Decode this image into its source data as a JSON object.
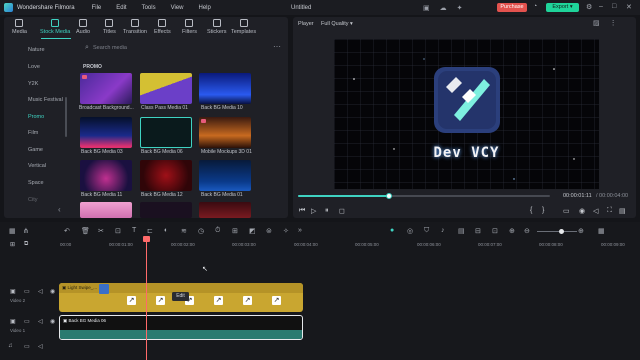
{
  "app": {
    "name": "Wondershare Filmora",
    "document_title": "Untitled"
  },
  "menu": [
    "File",
    "Edit",
    "Tools",
    "View",
    "Help"
  ],
  "header_buttons": {
    "purchase": "Purchase",
    "export": "Export"
  },
  "media_tabs": [
    {
      "label": "Media",
      "icon": "folder-icon"
    },
    {
      "label": "Stock Media",
      "icon": "stock-media-icon",
      "active": true
    },
    {
      "label": "Audio",
      "icon": "music-note-icon"
    },
    {
      "label": "Titles",
      "icon": "text-icon"
    },
    {
      "label": "Transition",
      "icon": "transition-icon"
    },
    {
      "label": "Effects",
      "icon": "effects-icon"
    },
    {
      "label": "Filters",
      "icon": "filters-icon"
    },
    {
      "label": "Stickers",
      "icon": "stickers-icon"
    },
    {
      "label": "Templates",
      "icon": "templates-icon"
    }
  ],
  "sidebar": {
    "items": [
      {
        "label": "Nature"
      },
      {
        "label": "Love"
      },
      {
        "label": "Y2K"
      },
      {
        "label": "Music Festival"
      },
      {
        "label": "Promo",
        "active": true
      },
      {
        "label": "Film"
      },
      {
        "label": "Game"
      },
      {
        "label": "Vertical"
      },
      {
        "label": "Space"
      },
      {
        "label": "City"
      }
    ]
  },
  "search": {
    "placeholder": "Search media"
  },
  "section_label": "PROMO",
  "media_grid": [
    {
      "label": "Broadcast Background...",
      "premium": true
    },
    {
      "label": "Class Pass Media 01"
    },
    {
      "label": "Back BG Media 10"
    },
    {
      "label": "Back BG Media 03"
    },
    {
      "label": "Back BG Media 06",
      "selected": true
    },
    {
      "label": "Mobile Mockups 3D 01",
      "premium": true
    },
    {
      "label": "Back BG Media 11"
    },
    {
      "label": "Back BG Media 12"
    },
    {
      "label": "Back BG Media 01"
    },
    {
      "label": ""
    },
    {
      "label": ""
    },
    {
      "label": ""
    }
  ],
  "player": {
    "label": "Player",
    "quality": "Full Quality",
    "preview_title": "Dev VCY",
    "current_time": "00:00:01:11",
    "total_time": "/ 00:00:04:00",
    "progress_fraction": 0.36
  },
  "timeline": {
    "ruler_ticks": [
      "00:00",
      "00:00:01:00",
      "00:00:02:00",
      "00:00:03:00",
      "00:00:04:00",
      "00:00:05:00",
      "00:00:06:00",
      "00:00:07:00",
      "00:00:08:00",
      "00:00:09:00"
    ],
    "tracks": [
      {
        "label": "Video 2",
        "clip": "Light Swipe_..."
      },
      {
        "label": "Video 1",
        "clip": "Back BG Media 06"
      }
    ],
    "tooltip": "Edit"
  }
}
